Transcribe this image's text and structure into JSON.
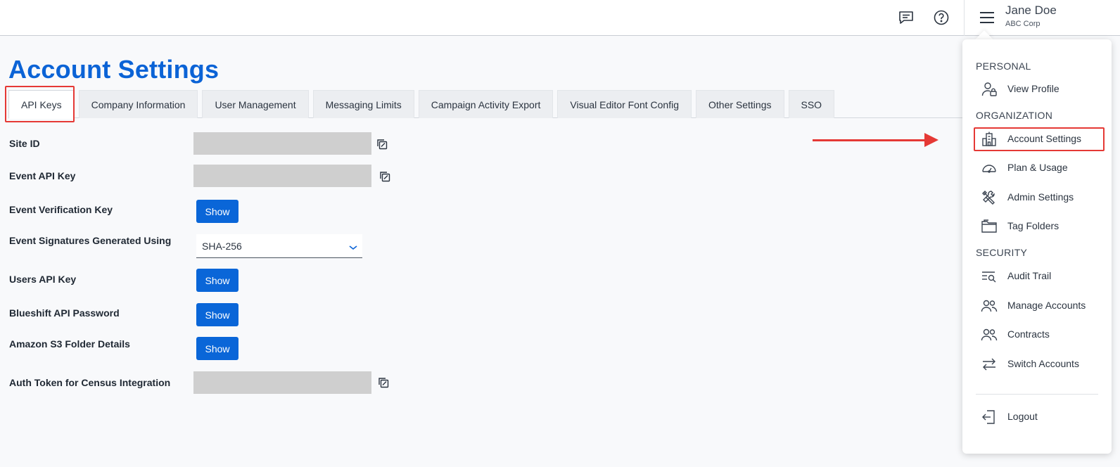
{
  "header": {
    "user_name": "Jane Doe",
    "user_company": "ABC Corp",
    "icons": [
      "feedback-icon",
      "help-icon",
      "hamburger-menu-icon"
    ]
  },
  "page": {
    "title": "Account Settings"
  },
  "tabs": [
    {
      "label": "API Keys",
      "active": true
    },
    {
      "label": "Company Information",
      "active": false
    },
    {
      "label": "User Management",
      "active": false
    },
    {
      "label": "Messaging Limits",
      "active": false
    },
    {
      "label": "Campaign Activity Export",
      "active": false
    },
    {
      "label": "Visual Editor Font Config",
      "active": false
    },
    {
      "label": "Other Settings",
      "active": false
    },
    {
      "label": "SSO",
      "active": false
    }
  ],
  "fields": {
    "site_id": {
      "label": "Site ID"
    },
    "event_api_key": {
      "label": "Event API Key"
    },
    "event_verification_key": {
      "label": "Event Verification Key",
      "button": "Show"
    },
    "event_signatures": {
      "label": "Event Signatures Generated Using",
      "value": "SHA-256"
    },
    "users_api_key": {
      "label": "Users API Key",
      "button": "Show"
    },
    "blueshift_api_password": {
      "label": "Blueshift API Password",
      "button": "Show"
    },
    "amazon_s3": {
      "label": "Amazon S3 Folder Details",
      "button": "Show"
    },
    "auth_token_census": {
      "label": "Auth Token for Census Integration"
    }
  },
  "menu": {
    "sections": {
      "personal": "PERSONAL",
      "organization": "ORGANIZATION",
      "security": "SECURITY"
    },
    "items": {
      "view_profile": {
        "label": "View Profile",
        "icon": "user-lock-icon"
      },
      "account_settings": {
        "label": "Account Settings",
        "icon": "building-icon"
      },
      "plan_usage": {
        "label": "Plan & Usage",
        "icon": "gauge-icon"
      },
      "admin_settings": {
        "label": "Admin Settings",
        "icon": "tools-icon"
      },
      "tag_folders": {
        "label": "Tag Folders",
        "icon": "folder-icon"
      },
      "audit_trail": {
        "label": "Audit Trail",
        "icon": "search-list-icon"
      },
      "manage_accounts": {
        "label": "Manage Accounts",
        "icon": "users-icon"
      },
      "contracts": {
        "label": "Contracts",
        "icon": "users-icon"
      },
      "switch_accounts": {
        "label": "Switch Accounts",
        "icon": "swap-arrows-icon"
      },
      "logout": {
        "label": "Logout",
        "icon": "logout-icon"
      }
    }
  },
  "colors": {
    "brand_blue": "#0b63d6",
    "button_blue": "#0a66d8",
    "highlight_red": "#e53935"
  }
}
